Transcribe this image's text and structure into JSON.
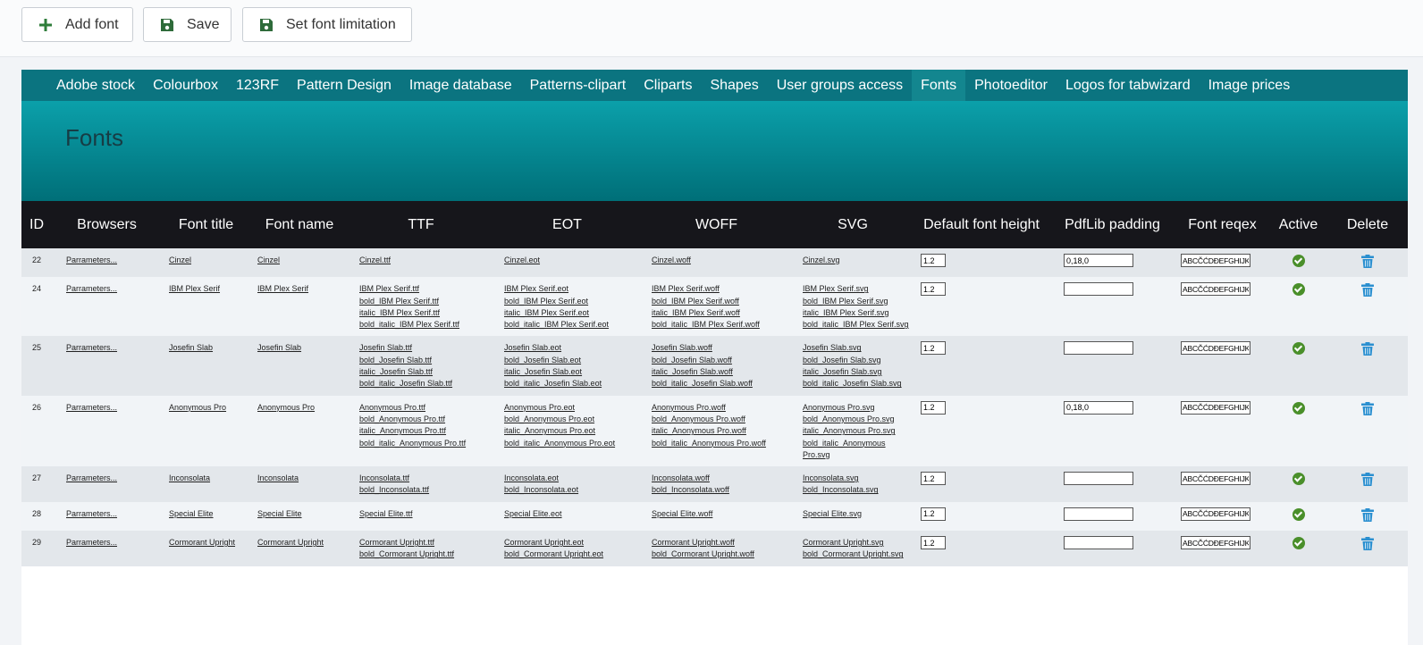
{
  "toolbar": {
    "add_font": "Add font",
    "save": "Save",
    "set_limitation": "Set font limitation"
  },
  "nav": [
    "Adobe stock",
    "Colourbox",
    "123RF",
    "Pattern Design",
    "Image database",
    "Patterns-clipart",
    "Cliparts",
    "Shapes",
    "User groups access",
    "Fonts",
    "Photoeditor",
    "Logos for tabwizard",
    "Image prices"
  ],
  "active_nav": "Fonts",
  "page_title": "Fonts",
  "columns": [
    "ID",
    "Browsers",
    "Font title",
    "Font name",
    "TTF",
    "EOT",
    "WOFF",
    "SVG",
    "Default font height",
    "PdfLib padding",
    "Font reqex",
    "Active",
    "Delete"
  ],
  "colors": {
    "nav_bg": "#0b7480",
    "header_bg": "#16161b",
    "active_icon": "#4a8f2a",
    "delete_icon": "#2a8fd0"
  },
  "rows": [
    {
      "id": "22",
      "browsers": "Parrameters...",
      "title": "Cinzel",
      "name": "Cinzel",
      "ttf": [
        "Cinzel.ttf"
      ],
      "eot": [
        "Cinzel.eot"
      ],
      "woff": [
        "Cinzel.woff"
      ],
      "svg": [
        "Cinzel.svg"
      ],
      "height": "1.2",
      "padding": "0,18,0",
      "regex": "ABCČĆDĐEFGHIJKLMNOPQRSŠTUVWXYZŽ",
      "active": true
    },
    {
      "id": "24",
      "browsers": "Parrameters...",
      "title": "IBM Plex Serif",
      "name": "IBM Plex Serif",
      "ttf": [
        "IBM Plex Serif.ttf",
        "bold_IBM Plex Serif.ttf",
        "italic_IBM Plex Serif.ttf",
        "bold_italic_IBM Plex Serif.ttf"
      ],
      "eot": [
        "IBM Plex Serif.eot",
        "bold_IBM Plex Serif.eot",
        "italic_IBM Plex Serif.eot",
        "bold_italic_IBM Plex Serif.eot"
      ],
      "woff": [
        "IBM Plex Serif.woff",
        "bold_IBM Plex Serif.woff",
        "italic_IBM Plex Serif.woff",
        "bold_italic_IBM Plex Serif.woff"
      ],
      "svg": [
        "IBM Plex Serif.svg",
        "bold_IBM Plex Serif.svg",
        "italic_IBM Plex Serif.svg",
        "bold_italic_IBM Plex Serif.svg"
      ],
      "height": "1.2",
      "padding": "",
      "regex": "ABCČĆDĐEFGHIJKLMNOPQRSŠTUVWXYZŽ",
      "active": true
    },
    {
      "id": "25",
      "browsers": "Parrameters...",
      "title": "Josefin Slab",
      "name": "Josefin Slab",
      "ttf": [
        "Josefin Slab.ttf",
        "bold_Josefin Slab.ttf",
        "italic_Josefin Slab.ttf",
        "bold_italic_Josefin Slab.ttf"
      ],
      "eot": [
        "Josefin Slab.eot",
        "bold_Josefin Slab.eot",
        "italic_Josefin Slab.eot",
        "bold_italic_Josefin Slab.eot"
      ],
      "woff": [
        "Josefin Slab.woff",
        "bold_Josefin Slab.woff",
        "italic_Josefin Slab.woff",
        "bold_italic_Josefin Slab.woff"
      ],
      "svg": [
        "Josefin Slab.svg",
        "bold_Josefin Slab.svg",
        "italic_Josefin Slab.svg",
        "bold_italic_Josefin Slab.svg"
      ],
      "height": "1.2",
      "padding": "",
      "regex": "ABCČĆDĐEFGHIJKLMNOPQRSŠTUVWXYZŽ",
      "active": true
    },
    {
      "id": "26",
      "browsers": "Parrameters...",
      "title": "Anonymous Pro",
      "name": "Anonymous Pro",
      "ttf": [
        "Anonymous Pro.ttf",
        "bold_Anonymous Pro.ttf",
        "italic_Anonymous Pro.ttf",
        "bold_italic_Anonymous Pro.ttf"
      ],
      "eot": [
        "Anonymous Pro.eot",
        "bold_Anonymous Pro.eot",
        "italic_Anonymous Pro.eot",
        "bold_italic_Anonymous Pro.eot"
      ],
      "woff": [
        "Anonymous Pro.woff",
        "bold_Anonymous Pro.woff",
        "italic_Anonymous Pro.woff",
        "bold_italic_Anonymous Pro.woff"
      ],
      "svg": [
        "Anonymous Pro.svg",
        "bold_Anonymous Pro.svg",
        "italic_Anonymous Pro.svg",
        "bold_italic_Anonymous Pro.svg"
      ],
      "height": "1.2",
      "padding": "0,18,0",
      "regex": "ABCČĆDĐEFGHIJKLMNOPQRSŠTUVWXYZŽ",
      "active": true
    },
    {
      "id": "27",
      "browsers": "Parrameters...",
      "title": "Inconsolata",
      "name": "Inconsolata",
      "ttf": [
        "Inconsolata.ttf",
        "bold_Inconsolata.ttf"
      ],
      "eot": [
        "Inconsolata.eot",
        "bold_Inconsolata.eot"
      ],
      "woff": [
        "Inconsolata.woff",
        "bold_Inconsolata.woff"
      ],
      "svg": [
        "Inconsolata.svg",
        "bold_Inconsolata.svg"
      ],
      "height": "1.2",
      "padding": "",
      "regex": "ABCČĆDĐEFGHIJKLMNOPQRSŠTUVWXYZŽ",
      "active": true
    },
    {
      "id": "28",
      "browsers": "Parrameters...",
      "title": "Special Elite",
      "name": "Special Elite",
      "ttf": [
        "Special Elite.ttf"
      ],
      "eot": [
        "Special Elite.eot"
      ],
      "woff": [
        "Special Elite.woff"
      ],
      "svg": [
        "Special Elite.svg"
      ],
      "height": "1.2",
      "padding": "",
      "regex": "ABCČĆDĐEFGHIJKLMNOPQRSŠTUVWXYZŽ",
      "active": true
    },
    {
      "id": "29",
      "browsers": "Parrameters...",
      "title": "Cormorant Upright",
      "name": "Cormorant Upright",
      "ttf": [
        "Cormorant Upright.ttf",
        "bold_Cormorant Upright.ttf"
      ],
      "eot": [
        "Cormorant Upright.eot",
        "bold_Cormorant Upright.eot"
      ],
      "woff": [
        "Cormorant Upright.woff",
        "bold_Cormorant Upright.woff"
      ],
      "svg": [
        "Cormorant Upright.svg",
        "bold_Cormorant Upright.svg"
      ],
      "height": "1.2",
      "padding": "",
      "regex": "ABCČĆDĐEFGHIJKLMNOPQRSŠTUVWXYZŽ",
      "active": true
    }
  ]
}
